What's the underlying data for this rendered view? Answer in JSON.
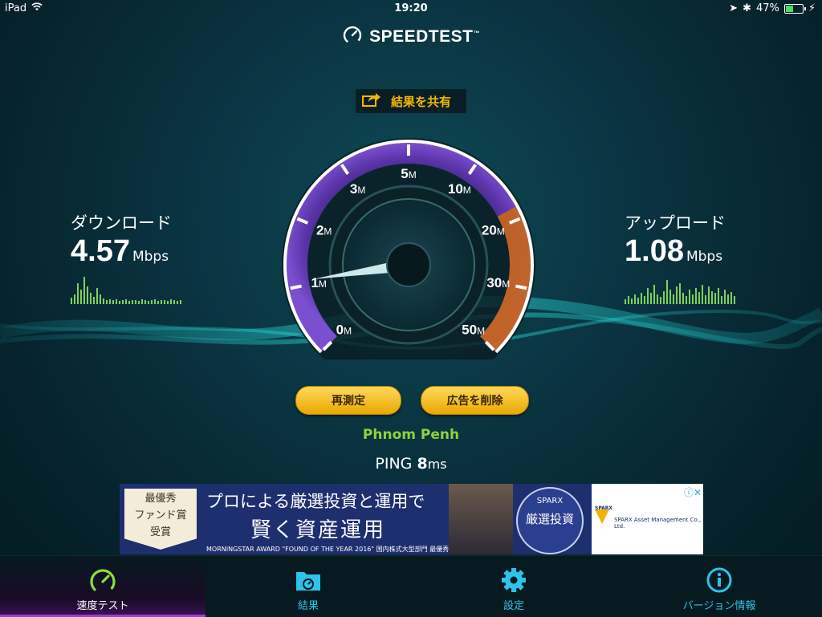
{
  "status": {
    "device": "iPad",
    "time": "19:20",
    "battery": "47%",
    "battery_level": 0.47
  },
  "app": {
    "title": "SPEEDTEST",
    "trademark": "™"
  },
  "share": {
    "label": "結果を共有"
  },
  "download": {
    "label": "ダウンロード",
    "value": "4.57",
    "unit": "Mbps"
  },
  "upload": {
    "label": "アップロード",
    "value": "1.08",
    "unit": "Mbps"
  },
  "gauge": {
    "scale": [
      "0",
      "1",
      "2",
      "3",
      "5",
      "10",
      "20",
      "30",
      "50"
    ],
    "unit": "M",
    "needle_value_mbps": 1.08
  },
  "buttons": {
    "retest": "再測定",
    "remove_ads": "広告を削除"
  },
  "server": {
    "location": "Phnom Penh"
  },
  "ping": {
    "label": "PING",
    "value": "8",
    "unit": "ms"
  },
  "ad": {
    "award_line1": "最優秀",
    "award_line2": "ファンド賞",
    "award_line3": "受賞",
    "headline": "プロによる厳選投資と運用で",
    "headline2": "賢く資産運用",
    "footer": "MORNINGSTAR AWARD \"FOUND OF THE YEAR 2016\" 国内株式大型部門 最優秀ファンド賞受賞",
    "seal_top": "SPARX",
    "seal_main": "厳選投資",
    "company": "SPARX Asset Management Co., Ltd.",
    "brand": "SPARX",
    "close": "ⓘ✕"
  },
  "tabs": [
    {
      "label": "速度テスト",
      "icon": "speedometer-icon",
      "active": true
    },
    {
      "label": "結果",
      "icon": "folder-icon",
      "active": false
    },
    {
      "label": "設定",
      "icon": "gear-icon",
      "active": false
    },
    {
      "label": "バージョン情報",
      "icon": "info-icon",
      "active": false
    }
  ],
  "colors": {
    "accent": "#f5b800",
    "tab_accent": "#2ec3ea",
    "location": "#8ed43b",
    "gauge_fill": "#6a3bb5",
    "gauge_upload": "#d9731a"
  }
}
